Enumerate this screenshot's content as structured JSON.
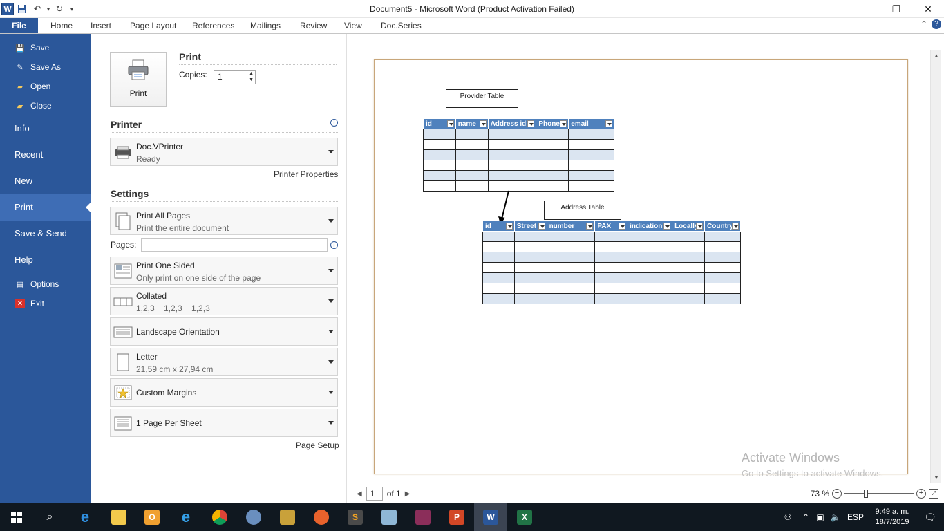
{
  "window": {
    "title": "Document5  -  Microsoft Word (Product Activation Failed)"
  },
  "ribbon": {
    "file": "File",
    "tabs": [
      "Home",
      "Insert",
      "Page Layout",
      "References",
      "Mailings",
      "Review",
      "View",
      "Doc.Series"
    ]
  },
  "nav": {
    "small_top": [
      "Save",
      "Save As",
      "Open",
      "Close"
    ],
    "big": [
      "Info",
      "Recent",
      "New",
      "Print",
      "Save & Send",
      "Help"
    ],
    "small_bottom": [
      "Options",
      "Exit"
    ],
    "active": "Print"
  },
  "print": {
    "section_title": "Print",
    "button_label": "Print",
    "copies_label": "Copies:",
    "copies_value": "1"
  },
  "printer": {
    "header": "Printer",
    "name": "Doc.VPrinter",
    "status": "Ready",
    "properties_link": "Printer Properties"
  },
  "settings": {
    "header": "Settings",
    "pages_label": "Pages:",
    "pages_value": "",
    "options": [
      {
        "title": "Print All Pages",
        "sub": "Print the entire document",
        "icon": "pages-icon"
      },
      {
        "title": "Print One Sided",
        "sub": "Only print on one side of the page",
        "icon": "one-sided-icon"
      },
      {
        "title": "Collated",
        "sub": "1,2,3    1,2,3    1,2,3",
        "icon": "collated-icon"
      },
      {
        "title": "Landscape Orientation",
        "sub": "",
        "icon": "landscape-icon"
      },
      {
        "title": "Letter",
        "sub": "21,59 cm x 27,94 cm",
        "icon": "paper-size-icon"
      },
      {
        "title": "Custom Margins",
        "sub": "",
        "icon": "margins-icon"
      },
      {
        "title": "1 Page Per Sheet",
        "sub": "",
        "icon": "pages-per-sheet-icon"
      }
    ],
    "page_setup_link": "Page Setup"
  },
  "document": {
    "provider_caption": "Provider Table",
    "provider_headers": [
      "id",
      "name",
      "Address id",
      "Phone",
      "email"
    ],
    "address_caption": "Address Table",
    "address_headers": [
      "id",
      "Street",
      "number",
      "PAX",
      "indications",
      "Locally",
      "Country"
    ]
  },
  "preview": {
    "page_current": "1",
    "page_of": "of 1",
    "zoom": "73 %",
    "watermark_title": "Activate Windows",
    "watermark_sub": "Go to Settings to activate Windows."
  },
  "taskbar": {
    "lang": "ESP",
    "time": "9:49 a. m.",
    "date": "18/7/2019"
  }
}
